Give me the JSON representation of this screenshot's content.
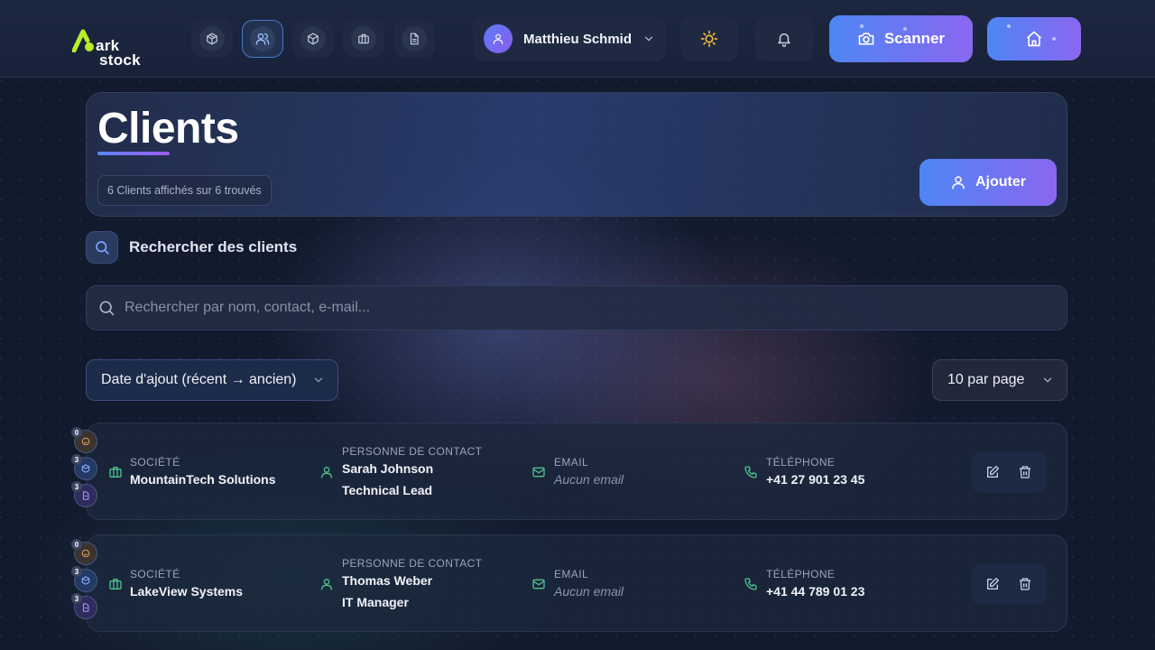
{
  "app": {
    "logo_line1": "ark",
    "logo_line2": "stock"
  },
  "header": {
    "nav_icons": [
      "box-icon",
      "users-icon",
      "package-icon",
      "briefcase-icon",
      "document-icon"
    ],
    "user_name": "Matthieu Schmid",
    "scanner_label": "Scanner"
  },
  "page": {
    "title": "Clients",
    "count_text": "6 Clients affichés sur 6 trouvés",
    "add_label": "Ajouter"
  },
  "search": {
    "heading": "Rechercher des clients",
    "placeholder": "Rechercher par nom, contact, e-mail..."
  },
  "filters": {
    "sort_value": "Date d'ajout (récent → ancien)",
    "per_page_value": "10 par page"
  },
  "labels": {
    "company": "SOCIÉTÉ",
    "contact": "PERSONNE DE CONTACT",
    "email": "EMAIL",
    "phone": "TÉLÉPHONE"
  },
  "clients": [
    {
      "badges": [
        "0",
        "3",
        "3"
      ],
      "company": "MountainTech Solutions",
      "contact_name": "Sarah Johnson",
      "contact_role": "Technical Lead",
      "email": "Aucun email",
      "phone": "+41 27 901 23 45"
    },
    {
      "badges": [
        "0",
        "3",
        "3"
      ],
      "company": "LakeView Systems",
      "contact_name": "Thomas Weber",
      "contact_role": "IT Manager",
      "email": "Aucun email",
      "phone": "+41 44 789 01 23"
    }
  ],
  "colors": {
    "accent_start": "#4e86f5",
    "accent_end": "#8a67ef",
    "field_icon_green": "#4cc38a",
    "sun_icon": "#f5b731",
    "background": "#121a2d"
  }
}
